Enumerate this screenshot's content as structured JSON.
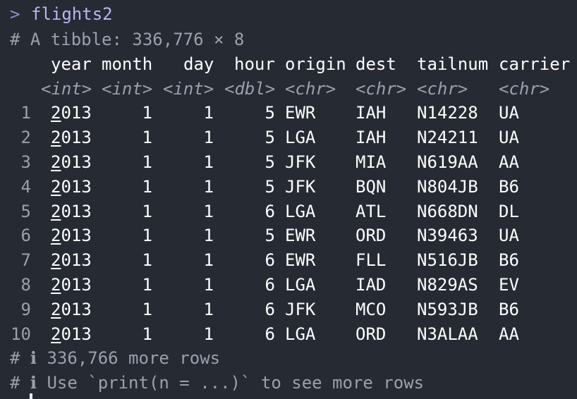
{
  "prompt": {
    "symbol": ">",
    "command": "flights2"
  },
  "summary_line": "# A tibble: 336,776 × 8",
  "columns": [
    "year",
    "month",
    "day",
    "hour",
    "origin",
    "dest",
    "tailnum",
    "carrier"
  ],
  "column_types": [
    "<int>",
    "<int>",
    "<int>",
    "<dbl>",
    "<chr>",
    "<chr>",
    "<chr>",
    "<chr>"
  ],
  "rows": [
    {
      "n": "1",
      "year_first": "2",
      "year_rest": "013",
      "month": "1",
      "day": "1",
      "hour": "5",
      "origin": "EWR",
      "dest": "IAH",
      "tailnum": "N14228",
      "carrier": "UA"
    },
    {
      "n": "2",
      "year_first": "2",
      "year_rest": "013",
      "month": "1",
      "day": "1",
      "hour": "5",
      "origin": "LGA",
      "dest": "IAH",
      "tailnum": "N24211",
      "carrier": "UA"
    },
    {
      "n": "3",
      "year_first": "2",
      "year_rest": "013",
      "month": "1",
      "day": "1",
      "hour": "5",
      "origin": "JFK",
      "dest": "MIA",
      "tailnum": "N619AA",
      "carrier": "AA"
    },
    {
      "n": "4",
      "year_first": "2",
      "year_rest": "013",
      "month": "1",
      "day": "1",
      "hour": "5",
      "origin": "JFK",
      "dest": "BQN",
      "tailnum": "N804JB",
      "carrier": "B6"
    },
    {
      "n": "5",
      "year_first": "2",
      "year_rest": "013",
      "month": "1",
      "day": "1",
      "hour": "6",
      "origin": "LGA",
      "dest": "ATL",
      "tailnum": "N668DN",
      "carrier": "DL"
    },
    {
      "n": "6",
      "year_first": "2",
      "year_rest": "013",
      "month": "1",
      "day": "1",
      "hour": "5",
      "origin": "EWR",
      "dest": "ORD",
      "tailnum": "N39463",
      "carrier": "UA"
    },
    {
      "n": "7",
      "year_first": "2",
      "year_rest": "013",
      "month": "1",
      "day": "1",
      "hour": "6",
      "origin": "EWR",
      "dest": "FLL",
      "tailnum": "N516JB",
      "carrier": "B6"
    },
    {
      "n": "8",
      "year_first": "2",
      "year_rest": "013",
      "month": "1",
      "day": "1",
      "hour": "6",
      "origin": "LGA",
      "dest": "IAD",
      "tailnum": "N829AS",
      "carrier": "EV"
    },
    {
      "n": "9",
      "year_first": "2",
      "year_rest": "013",
      "month": "1",
      "day": "1",
      "hour": "6",
      "origin": "JFK",
      "dest": "MCO",
      "tailnum": "N593JB",
      "carrier": "B6"
    },
    {
      "n": "10",
      "year_first": "2",
      "year_rest": "013",
      "month": "1",
      "day": "1",
      "hour": "6",
      "origin": "LGA",
      "dest": "ORD",
      "tailnum": "N3ALAA",
      "carrier": "AA"
    }
  ],
  "footer": {
    "line1": "# ℹ 336,766 more rows",
    "line2": "# ℹ Use `print(n = ...)` to see more rows"
  }
}
